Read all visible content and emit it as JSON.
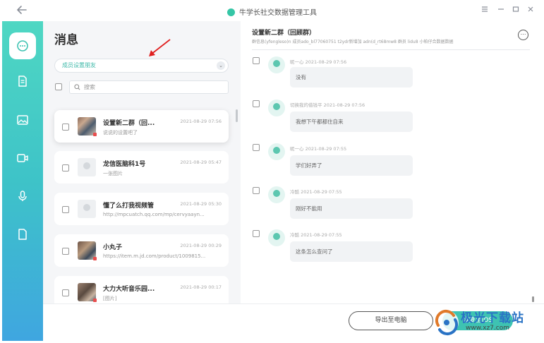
{
  "window": {
    "title": "牛学长社交数据管理工具",
    "back_icon": "arrow-left-icon",
    "controls": [
      "menu-icon",
      "minimize-icon",
      "maximize-icon",
      "close-icon"
    ]
  },
  "sidebar": {
    "items": [
      {
        "icon": "chat-icon",
        "active": true
      },
      {
        "icon": "document-icon",
        "active": false
      },
      {
        "icon": "image-icon",
        "active": false
      },
      {
        "icon": "video-icon",
        "active": false
      },
      {
        "icon": "microphone-icon",
        "active": false
      },
      {
        "icon": "file-icon",
        "active": false
      }
    ],
    "accent_top": "#4fd7c3",
    "accent_bottom": "#3fa6e0"
  },
  "left": {
    "title": "消息",
    "dropdown_value": "成员设置朋友",
    "search_placeholder": "搜索",
    "contacts": [
      {
        "name": "设置新二群（回...",
        "time": "2021-08-29 07:56",
        "preview": "说说的设置吧了",
        "avatar": "photo",
        "selected": true
      },
      {
        "name": "龙信医脑科1号",
        "time": "2021-08-29 05:47",
        "preview": "一张图片",
        "avatar": "placeholder",
        "selected": false
      },
      {
        "name": "懂了么打我视频管",
        "time": "2021-08-29 05:30",
        "preview": "http://mpcuatch.qq.com/mp/cervyaayn...",
        "avatar": "placeholder",
        "selected": false
      },
      {
        "name": "小丸子",
        "time": "2021-08-29 00:29",
        "preview": "https://item.m.jd.com/product/1009815...",
        "avatar": "photo2",
        "selected": false
      },
      {
        "name": "大力大听音乐园...",
        "time": "2021-08-29 00:17",
        "preview": "[图片]",
        "avatar": "photo3",
        "selected": false
      }
    ]
  },
  "chat": {
    "title": "设置新二群（回顾群）",
    "subtitle": "群信息(yfengleso)n 成员ado_bl77060751 t2ydr新增加 adn(d_rt68mw8 群员 lidu8 小帕仔合数据数据",
    "more_icon": "more-icon",
    "messages": [
      {
        "meta": "昵一心  2021-08-29 07:56",
        "text": "没有"
      },
      {
        "meta": "切换我的借钱平  2021-08-29 07:56",
        "text": "我想下午都都住自来"
      },
      {
        "meta": "昵一心  2021-08-29 07:55",
        "text": "学们好弄了"
      },
      {
        "meta": "冷酷  2021-08-29 07:55",
        "text": "刚好不能用"
      },
      {
        "meta": "冷酷  2021-08-29 07:55",
        "text": "这条怎么查问了"
      }
    ]
  },
  "footer": {
    "export_label": "导出至电脑",
    "restore_label": "恢复至iOS"
  },
  "watermark": {
    "brand": "极光下载站",
    "url": "www.xz7.com"
  }
}
